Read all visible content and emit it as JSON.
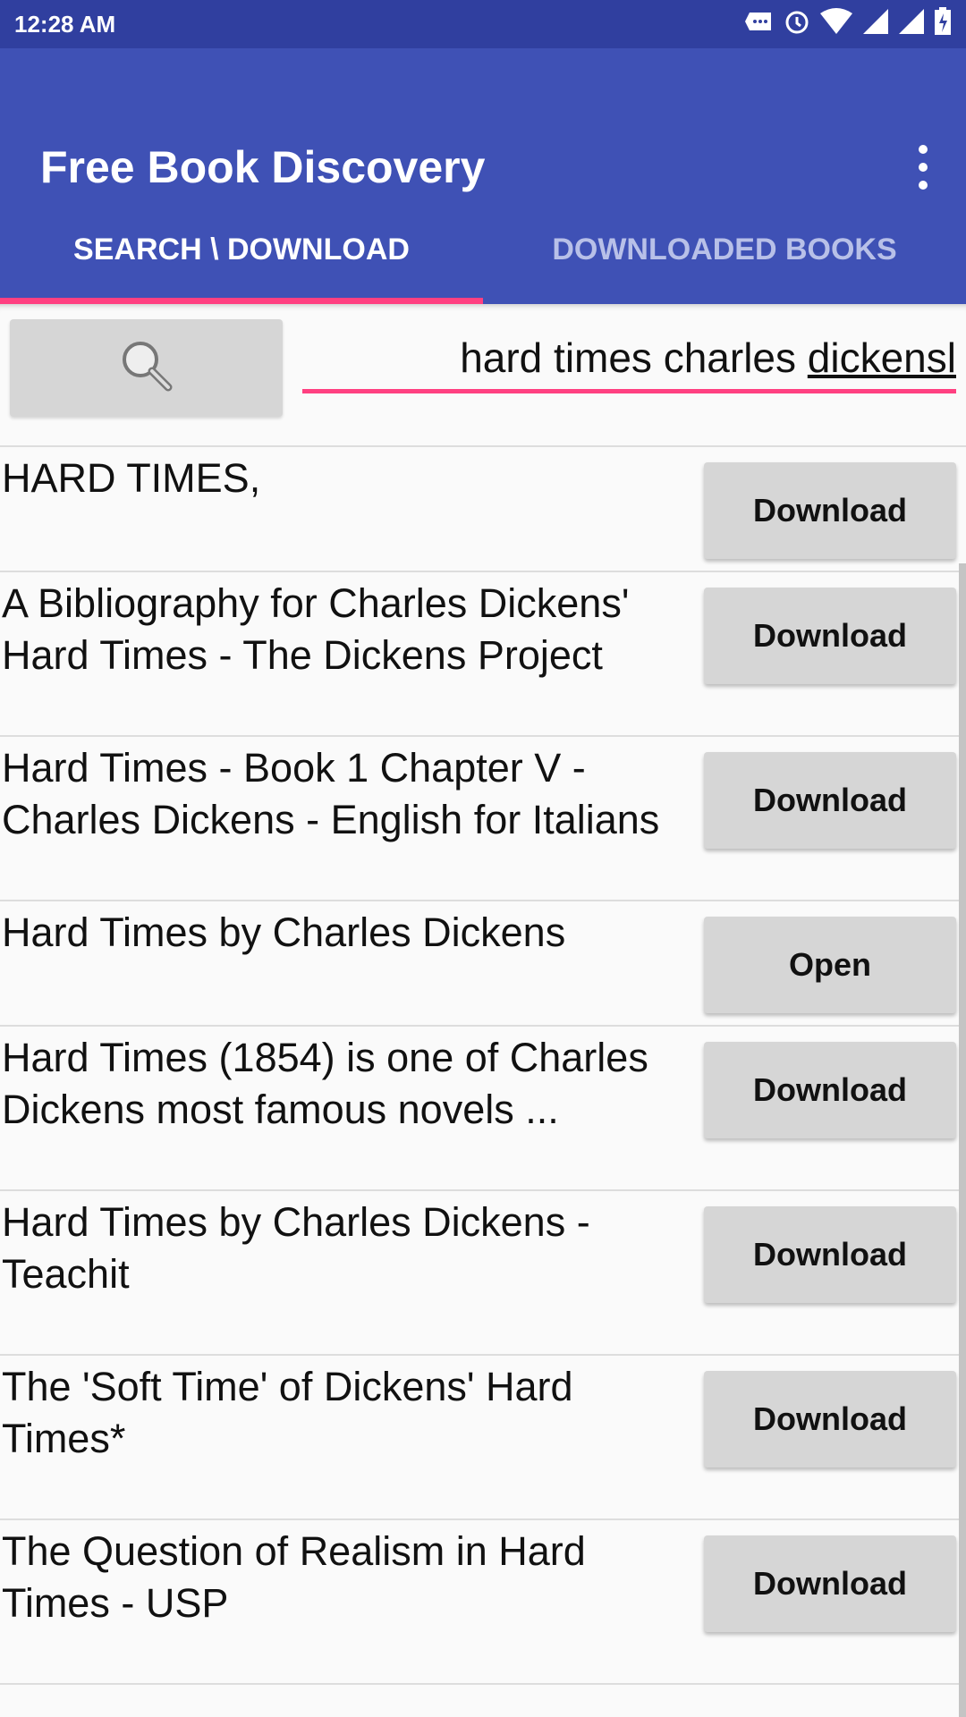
{
  "status_bar": {
    "time": "12:28 AM",
    "icons": [
      "message-icon",
      "alarm-icon",
      "wifi-icon",
      "signal-icon",
      "signal-icon",
      "battery-charging-icon"
    ]
  },
  "app_bar": {
    "title": "Free Book Discovery",
    "menu_icon": "more-vert-icon"
  },
  "tabs": [
    {
      "label": "SEARCH \\ DOWNLOAD",
      "active": true
    },
    {
      "label": "DOWNLOADED BOOKS",
      "active": false
    }
  ],
  "search": {
    "button_icon": "search-icon",
    "value_plain": "hard times charles ",
    "value_underlined": "dickensl"
  },
  "colors": {
    "primary": "#3f51b5",
    "primary_dark": "#303f9f",
    "accent": "#ff4081",
    "button": "#d6d6d6"
  },
  "results": [
    {
      "title": "HARD TIMES,",
      "action": "Download"
    },
    {
      "title": "A Bibliography for Charles Dickens' Hard Times - The Dickens Project",
      "action": "Download"
    },
    {
      "title": "Hard Times - Book 1 Chapter V - Charles Dickens - English for Italians",
      "action": "Download"
    },
    {
      "title": "Hard Times by Charles Dickens",
      "action": "Open"
    },
    {
      "title": "Hard Times (1854) is one of Charles Dickens most famous novels ...",
      "action": "Download"
    },
    {
      "title": "Hard Times by Charles Dickens - Teachit",
      "action": "Download"
    },
    {
      "title": "The 'Soft Time' of Dickens' Hard Times*",
      "action": "Download"
    },
    {
      "title": "The Question of Realism in Hard Times - USP",
      "action": "Download"
    }
  ]
}
